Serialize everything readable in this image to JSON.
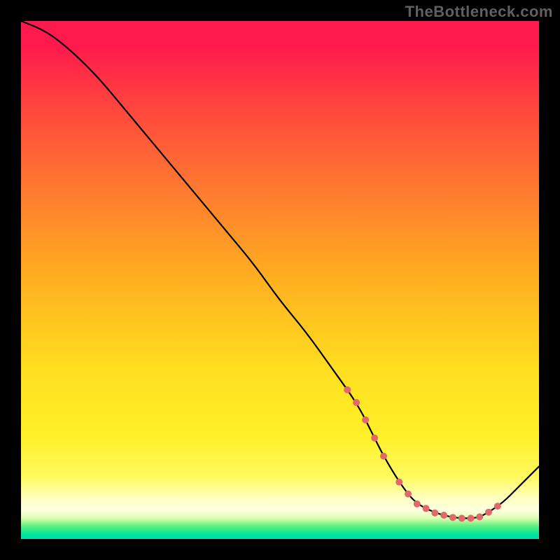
{
  "watermark": "TheBottleneck.com",
  "chart_data": {
    "type": "line",
    "title": "",
    "xlabel": "",
    "ylabel": "",
    "ylim": [
      0,
      100
    ],
    "x": [
      0,
      5,
      10,
      15,
      20,
      25,
      30,
      35,
      40,
      45,
      50,
      55,
      60,
      65,
      68,
      70,
      73,
      76,
      80,
      84,
      88,
      90,
      93,
      96,
      100
    ],
    "values": [
      100,
      98,
      94,
      89,
      83,
      77,
      71,
      65,
      59,
      53,
      46,
      40,
      33,
      26,
      20,
      16,
      11,
      7,
      5,
      4,
      4,
      5,
      7,
      10,
      14
    ],
    "dotted_segments": [
      {
        "x_range": [
          63,
          70
        ],
        "y_range": [
          28,
          14
        ]
      },
      {
        "x_range": [
          73,
          92
        ],
        "y_range": [
          9,
          6
        ]
      }
    ],
    "gradient_stops": [
      {
        "pos": 0,
        "color": "#ff1a4d"
      },
      {
        "pos": 50,
        "color": "#ffe020"
      },
      {
        "pos": 92,
        "color": "#ffffc0"
      },
      {
        "pos": 97,
        "color": "#60f080"
      },
      {
        "pos": 100,
        "color": "#00d8b8"
      }
    ]
  }
}
